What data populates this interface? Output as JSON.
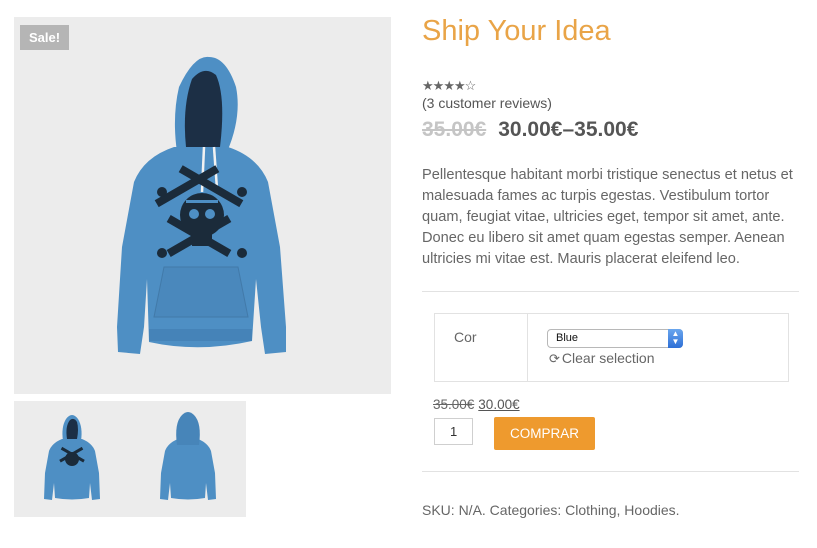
{
  "product": {
    "title": "Ship Your Idea",
    "sale_badge": "Sale!",
    "rating": 4,
    "rating_max": 5,
    "reviews_label": "(3 customer reviews)",
    "price_old": "35.00€",
    "price_range": "30.00€–35.00€",
    "description": "Pellentesque habitant morbi tristique senectus et netus et malesuada fames ac turpis egestas. Vestibulum tortor quam, feugiat vitae, ultricies eget, tempor sit amet, ante. Donec eu libero sit amet quam egestas semper. Aenean ultricies mi vitae est. Mauris placerat eleifend leo."
  },
  "variations": {
    "label": "Cor",
    "selected": "Blue",
    "clear_label": "Clear selection",
    "price_old": "35.00€",
    "price_new": "30.00€"
  },
  "cart": {
    "quantity": "1",
    "button_label": "COMPRAR"
  },
  "meta": {
    "text": "SKU: N/A. Categories: Clothing, Hoodies."
  },
  "colors": {
    "accent": "#e9a447",
    "button": "#ee9a2e",
    "hoodie": "#4e8fc4"
  }
}
